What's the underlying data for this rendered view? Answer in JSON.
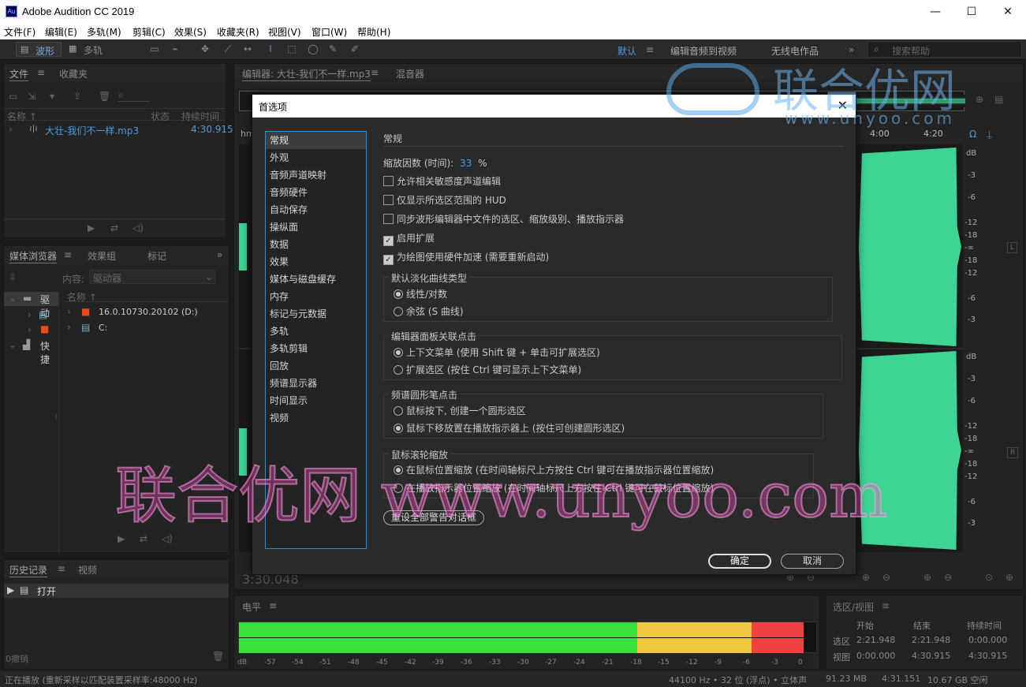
{
  "app": {
    "icon_text": "Au",
    "title": "Adobe Audition CC 2019"
  },
  "window": {
    "minimize": "—",
    "maximize": "☐",
    "close": "✕"
  },
  "menu": [
    "文件(F)",
    "编辑(E)",
    "多轨(M)",
    "剪辑(C)",
    "效果(S)",
    "收藏夹(R)",
    "视图(V)",
    "窗口(W)",
    "帮助(H)"
  ],
  "toolbar": {
    "waveform": "波形",
    "multitrack": "多轨",
    "workspace_default": "默认",
    "workspace_menu_icon": "≡",
    "workspace_edit_video": "编辑音频到视频",
    "workspace_radio": "无线电作品",
    "more": "»",
    "search_placeholder": "搜索帮助"
  },
  "files_panel": {
    "tab_files": "文件",
    "tab_menu": "≡",
    "tab_favorites": "收藏夹",
    "col_name": "名称 ↑",
    "col_status": "状态",
    "col_duration": "持续时间",
    "file_name": "大壮-我们不一样.mp3",
    "file_duration": "4:30.915"
  },
  "media_panel": {
    "tab_media": "媒体浏览器",
    "tab_menu": "≡",
    "tab_effects": "效果组",
    "tab_markers": "标记",
    "content_label": "内容:",
    "content_value": "驱动器",
    "col_name": "名称 ↑",
    "left_items": [
      "驱动",
      "快捷"
    ],
    "drives": [
      "16.0.10730.20102 (D:)",
      "C:"
    ]
  },
  "history_panel": {
    "tab_history": "历史记录",
    "tab_menu": "≡",
    "tab_video": "视频",
    "item": "打开",
    "undo": "0撤销"
  },
  "editor": {
    "tab_editor": "编辑器: 大壮-我们不一样.mp3",
    "tab_menu": "≡",
    "tab_mixer": "混音器",
    "time_display": "3:30.048",
    "hms": "hms",
    "ruler": [
      "4:00",
      "4:20"
    ],
    "db_top": [
      "dB",
      "-3",
      "-6",
      "-12",
      "-18",
      "-∞",
      "-18",
      "-12",
      "-6",
      "-3"
    ],
    "db_bottom": [
      "dB",
      "-3",
      "-6",
      "-12",
      "-18",
      "-∞",
      "-18",
      "-12",
      "-6",
      "-3"
    ],
    "channel_l": "L",
    "channel_r": "R"
  },
  "levels": {
    "title": "电平",
    "menu": "≡",
    "scale": [
      "dB",
      "-57",
      "-54",
      "-51",
      "-48",
      "-45",
      "-42",
      "-39",
      "-36",
      "-33",
      "-30",
      "-27",
      "-24",
      "-21",
      "-18",
      "-15",
      "-12",
      "-9",
      "-6",
      "-3",
      "0"
    ]
  },
  "selection": {
    "title": "选区/视图",
    "menu": "≡",
    "col_start": "开始",
    "col_end": "结束",
    "col_duration": "持续时间",
    "row_selection": "选区",
    "row_view": "视图",
    "sel_start": "2:21.948",
    "sel_end": "2:21.948",
    "sel_duration": "0:00.000",
    "view_start": "0:00.000",
    "view_end": "4:30.915",
    "view_duration": "4:30.915"
  },
  "status": {
    "left": "正在播放 (重新采样以匹配装置采样率:48000 Hz)",
    "format": "44100 Hz • 32 位 (浮点) • 立体声",
    "size": "91.23 MB",
    "duration": "4:31.151",
    "free": "10.67 GB 空闲"
  },
  "dialog": {
    "title": "首选项",
    "close": "✕",
    "categories": [
      "常规",
      "外观",
      "音频声道映射",
      "音频硬件",
      "自动保存",
      "操纵面",
      "数据",
      "效果",
      "媒体与磁盘缓存",
      "内存",
      "标记与元数据",
      "多轨",
      "多轨剪辑",
      "回放",
      "频谱显示器",
      "时间显示",
      "视频"
    ],
    "section": "常规",
    "zoom_label": "缩放因数 (时间):",
    "zoom_value": "33",
    "zoom_unit": "%",
    "checks": [
      {
        "label": "允许相关敏感度声道编辑",
        "checked": false
      },
      {
        "label": "仅显示所选区范围的 HUD",
        "checked": false
      },
      {
        "label": "同步波形编辑器中文件的选区、缩放级别、播放指示器",
        "checked": false
      },
      {
        "label": "启用扩展",
        "checked": true
      },
      {
        "label": "为绘图使用硬件加速 (需要重新启动)",
        "checked": true
      }
    ],
    "fade_title": "默认淡化曲线类型",
    "fade_options": [
      "线性/对数",
      "余弦 (S 曲线)"
    ],
    "ctx_title": "编辑器面板关联点击",
    "ctx_options": [
      "上下文菜单 (使用 Shift 键 + 单击可扩展选区)",
      "扩展选区 (按住 Ctrl 键可显示上下文菜单)"
    ],
    "brush_title": "频谱圆形笔点击",
    "brush_options": [
      "鼠标按下, 创建一个圆形选区",
      "鼠标下移放置在播放指示器上 (按住可创建圆形选区)"
    ],
    "wheel_title": "鼠标滚轮缩放",
    "wheel_options": [
      "在鼠标位置缩放 (在时间轴标尺上方按住 Ctrl 键可在播放指示器位置缩放)",
      "在播放指示器位置缩放 (在时间轴标尺上方按住 Ctrl 键可在鼠标位置缩放)"
    ],
    "reset_button": "重设全部警告对话框",
    "ok_button": "确定",
    "cancel_button": "取消"
  },
  "watermark": {
    "logo_text": "联合优网",
    "logo_url": "www.unyoo.com",
    "big_text": "联合优网 www.unyoo.com"
  },
  "colors": {
    "waveform": "#3fd494",
    "accent": "#2b8fd8",
    "meter_green": "#39e039",
    "meter_yellow": "#f0c840",
    "meter_red": "#f04040"
  },
  "meter_levels": {
    "green_end_db": -18,
    "yellow_end_db": -6,
    "red_end_db": -0.5
  }
}
